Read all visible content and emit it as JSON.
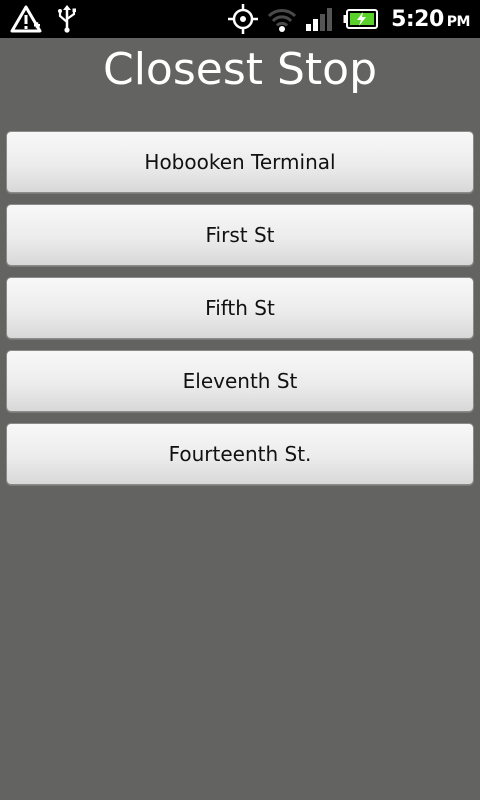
{
  "status_bar": {
    "time": "5:20",
    "ampm": "PM",
    "icons": [
      "alert-icon",
      "usb-icon",
      "gps-icon",
      "wifi-icon",
      "signal-icon",
      "battery-charging-icon"
    ]
  },
  "screen": {
    "title": "Closest Stop"
  },
  "stops": [
    {
      "label": "Hobooken Terminal"
    },
    {
      "label": "First St"
    },
    {
      "label": "Fifth St"
    },
    {
      "label": "Eleventh St"
    },
    {
      "label": "Fourteenth St."
    }
  ],
  "colors": {
    "background": "#636461",
    "status_bar": "#000000",
    "battery_fill": "#5ad12a"
  }
}
